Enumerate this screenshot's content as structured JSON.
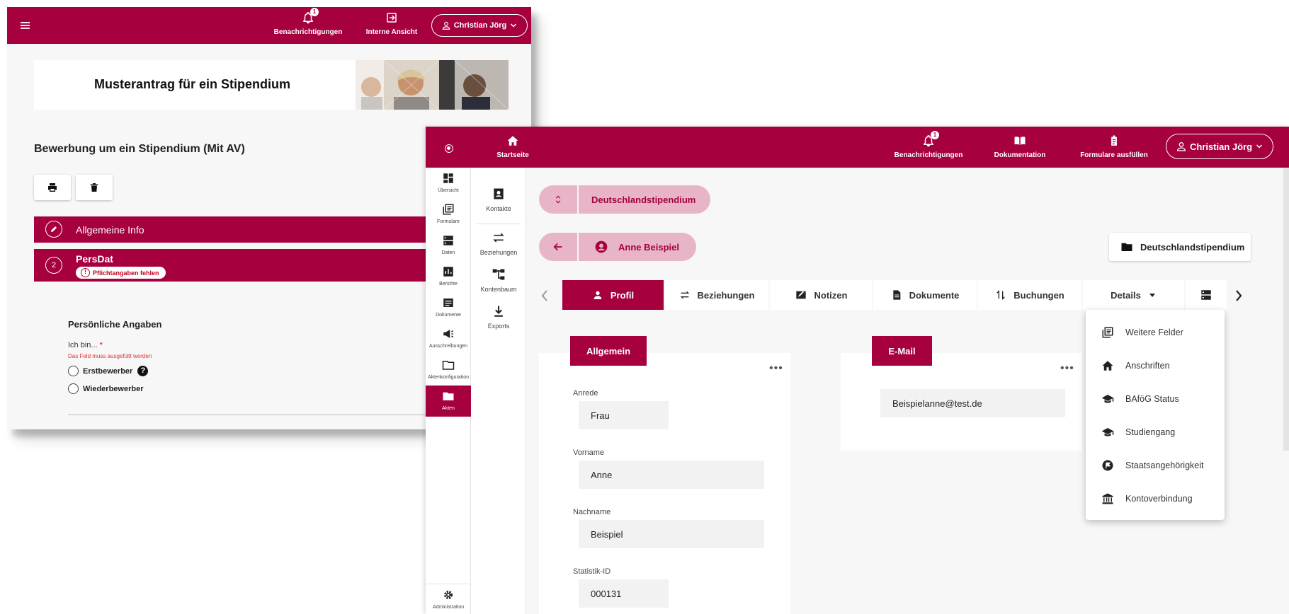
{
  "back_window": {
    "nav": {
      "notifications": "Benachrichtigungen",
      "notif_count": "1",
      "internal_view": "Interne Ansicht",
      "user": "Christian Jörg"
    },
    "banner_title": "Musterantrag für ein Stipendium",
    "subtitle": "Bewerbung um ein Stipendium (Mit AV)",
    "section1": {
      "title": "Allgemeine Info"
    },
    "section2": {
      "number": "2",
      "title": "PersDat",
      "warning": "Pflichtangaben fehlen"
    },
    "form": {
      "heading": "Persönliche Angaben",
      "label": "Ich bin...",
      "required_mark": "*",
      "error": "Das Feld muss ausgefüllt werden",
      "options": [
        "Erstbewerber",
        "Wiederbewerber"
      ],
      "help": "?"
    }
  },
  "front_window": {
    "nav": {
      "home": "Startseite",
      "notifications": "Benachrichtigungen",
      "notif_count": "1",
      "documentation": "Dokumentation",
      "fill_forms": "Formulare ausfüllen",
      "user": "Christian Jörg"
    },
    "rail": [
      "Übersicht",
      "Formulare",
      "Daten",
      "Berichte",
      "Dokumente",
      "Ausschreibungen",
      "Aktenkonfiguration",
      "Akten"
    ],
    "rail_active": "Akten",
    "rail_bottom": "Administration",
    "rail2": [
      "Kontakte",
      "Beziehungen",
      "Kontenbaum",
      "Exports"
    ],
    "chip_program": "Deutschlandstipendium",
    "chip_person": "Anne Beispiel",
    "folder_button": "Deutschlandstipendium",
    "tabs": [
      "Profil",
      "Beziehungen",
      "Notizen",
      "Dokumente",
      "Buchungen",
      "Details"
    ],
    "active_tab": "Profil",
    "cards": {
      "general": {
        "title": "Allgemein",
        "fields": [
          {
            "label": "Anrede",
            "value": "Frau"
          },
          {
            "label": "Vorname",
            "value": "Anne"
          },
          {
            "label": "Nachname",
            "value": "Beispiel"
          },
          {
            "label": "Statistik-ID",
            "value": "000131"
          }
        ]
      },
      "email": {
        "title": "E-Mail",
        "value": "Beispielanne@test.de"
      }
    },
    "details_menu": [
      {
        "label": "Weitere Felder",
        "icon": "list-icon"
      },
      {
        "label": "Anschriften",
        "icon": "home-icon"
      },
      {
        "label": "BAföG Status",
        "icon": "graduation-cap-icon"
      },
      {
        "label": "Studiengang",
        "icon": "graduation-cap-icon"
      },
      {
        "label": "Staatsangehörigkeit",
        "icon": "flag-icon"
      },
      {
        "label": "Kontoverbindung",
        "icon": "bank-icon"
      }
    ]
  },
  "colors": {
    "brand": "#a6003f",
    "chip": "#e8b5c8",
    "error": "#d00020"
  }
}
